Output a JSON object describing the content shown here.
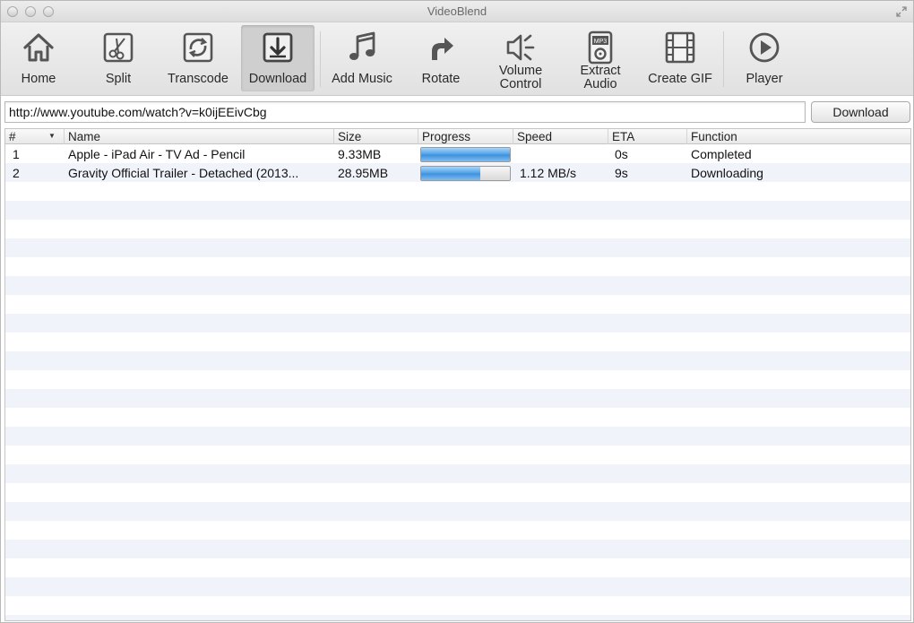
{
  "window": {
    "title": "VideoBlend"
  },
  "toolbar": {
    "tools": [
      {
        "label": "Home",
        "icon": "home-icon"
      },
      {
        "label": "Split",
        "icon": "scissors-icon"
      },
      {
        "label": "Transcode",
        "icon": "transcode-icon"
      },
      {
        "label": "Download",
        "icon": "download-icon",
        "active": true
      },
      {
        "label": "Add Music",
        "icon": "music-note-icon"
      },
      {
        "label": "Rotate",
        "icon": "rotate-arrow-icon"
      },
      {
        "label": "Volume Control",
        "icon": "speaker-icon"
      },
      {
        "label": "Extract Audio",
        "icon": "mp3-player-icon"
      },
      {
        "label": "Create GIF",
        "icon": "film-strip-icon"
      },
      {
        "label": "Player",
        "icon": "play-circle-icon"
      }
    ]
  },
  "url_input": {
    "value": "http://www.youtube.com/watch?v=k0ijEEivCbg"
  },
  "download_button": {
    "label": "Download"
  },
  "table": {
    "columns": {
      "num": "#",
      "name": "Name",
      "size": "Size",
      "progress": "Progress",
      "speed": "Speed",
      "eta": "ETA",
      "function": "Function"
    },
    "rows": [
      {
        "num": "1",
        "name": "Apple - iPad Air - TV Ad - Pencil",
        "size": "9.33MB",
        "progress": 1.0,
        "speed": "",
        "eta": "0s",
        "function": "Completed"
      },
      {
        "num": "2",
        "name": "Gravity Official Trailer - Detached (2013...",
        "size": "28.95MB",
        "progress": 0.67,
        "speed": "1.12 MB/s",
        "eta": "9s",
        "function": "Downloading"
      }
    ]
  },
  "colors": {
    "progress_fill": "#4b9ee6",
    "row_stripe": "#f0f4fa",
    "active_tool": "#cfcfcf"
  }
}
